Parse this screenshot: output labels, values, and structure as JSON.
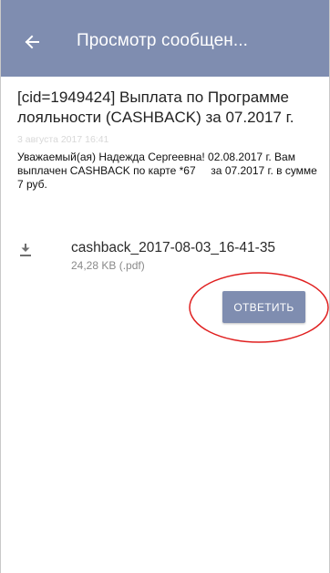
{
  "appbar": {
    "title": "Просмотр сообщен...",
    "back_icon": "arrow-left-icon",
    "color": "#7f8db0"
  },
  "message": {
    "subject": "[cid=1949424] Выплата по Программе лояльности (CASHBACK) за 07.2017 г.",
    "date": "3 августа 2017 16:41",
    "body": "Уважаемый(ая) Надежда Сергеевна! 02.08.2017 г. Вам выплачен CASHBACK по карте *67     за 07.2017 г. в сумме 7 руб."
  },
  "attachment": {
    "icon": "download-icon",
    "file_name": "cashback_2017-08-03_16-41-35",
    "file_meta": "24,28 KB (.pdf)"
  },
  "actions": {
    "reply_label": "ОТВЕТИТЬ",
    "highlight_color": "#e02020"
  }
}
